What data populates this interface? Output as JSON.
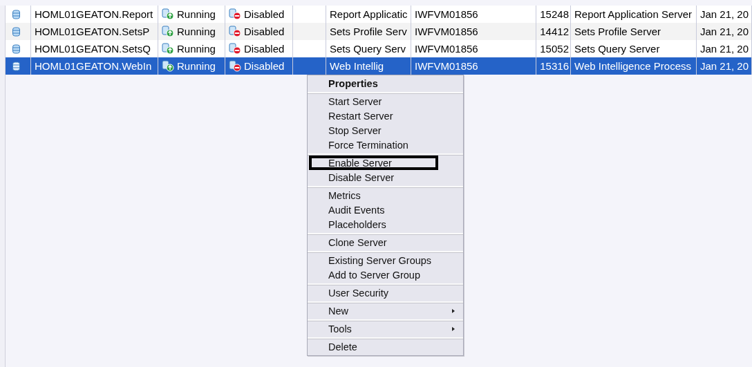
{
  "table": {
    "rows": [
      {
        "name": "HOML01GEATON.Report",
        "status": "Running",
        "enabled": "Disabled",
        "description": "Report Applicatic",
        "host": "IWFVM01856",
        "pid": "15248",
        "type": "Report Application Server",
        "date": "Jan 21, 20",
        "selected": false
      },
      {
        "name": "HOML01GEATON.SetsP",
        "status": "Running",
        "enabled": "Disabled",
        "description": "Sets Profile Serv",
        "host": "IWFVM01856",
        "pid": "14412",
        "type": "Sets Profile Server",
        "date": "Jan 21, 20",
        "selected": false
      },
      {
        "name": "HOML01GEATON.SetsQ",
        "status": "Running",
        "enabled": "Disabled",
        "description": "Sets Query Serv",
        "host": "IWFVM01856",
        "pid": "15052",
        "type": "Sets Query Server",
        "date": "Jan 21, 20",
        "selected": false
      },
      {
        "name": "HOML01GEATON.WebIn",
        "status": "Running",
        "enabled": "Disabled",
        "description": "Web Intellig",
        "host": "IWFVM01856",
        "pid": "15316",
        "type": "Web Intelligence Process",
        "date": "Jan 21, 20",
        "selected": true
      }
    ]
  },
  "context_menu": {
    "groups": [
      [
        {
          "label": "Properties",
          "bold": true,
          "submenu": false,
          "highlighted": false
        }
      ],
      [
        {
          "label": "Start Server",
          "bold": false,
          "submenu": false,
          "highlighted": false
        },
        {
          "label": "Restart Server",
          "bold": false,
          "submenu": false,
          "highlighted": false
        },
        {
          "label": "Stop Server",
          "bold": false,
          "submenu": false,
          "highlighted": false
        },
        {
          "label": "Force Termination",
          "bold": false,
          "submenu": false,
          "highlighted": false
        }
      ],
      [
        {
          "label": "Enable Server",
          "bold": false,
          "submenu": false,
          "highlighted": true
        },
        {
          "label": "Disable Server",
          "bold": false,
          "submenu": false,
          "highlighted": false
        }
      ],
      [
        {
          "label": "Metrics",
          "bold": false,
          "submenu": false,
          "highlighted": false
        },
        {
          "label": "Audit Events",
          "bold": false,
          "submenu": false,
          "highlighted": false
        },
        {
          "label": "Placeholders",
          "bold": false,
          "submenu": false,
          "highlighted": false
        }
      ],
      [
        {
          "label": "Clone Server",
          "bold": false,
          "submenu": false,
          "highlighted": false
        }
      ],
      [
        {
          "label": "Existing Server Groups",
          "bold": false,
          "submenu": false,
          "highlighted": false
        },
        {
          "label": "Add to Server Group",
          "bold": false,
          "submenu": false,
          "highlighted": false
        }
      ],
      [
        {
          "label": "User Security",
          "bold": false,
          "submenu": false,
          "highlighted": false
        }
      ],
      [
        {
          "label": "New",
          "bold": false,
          "submenu": true,
          "highlighted": false
        }
      ],
      [
        {
          "label": "Tools",
          "bold": false,
          "submenu": true,
          "highlighted": false
        }
      ],
      [
        {
          "label": "Delete",
          "bold": false,
          "submenu": false,
          "highlighted": false
        }
      ]
    ]
  }
}
